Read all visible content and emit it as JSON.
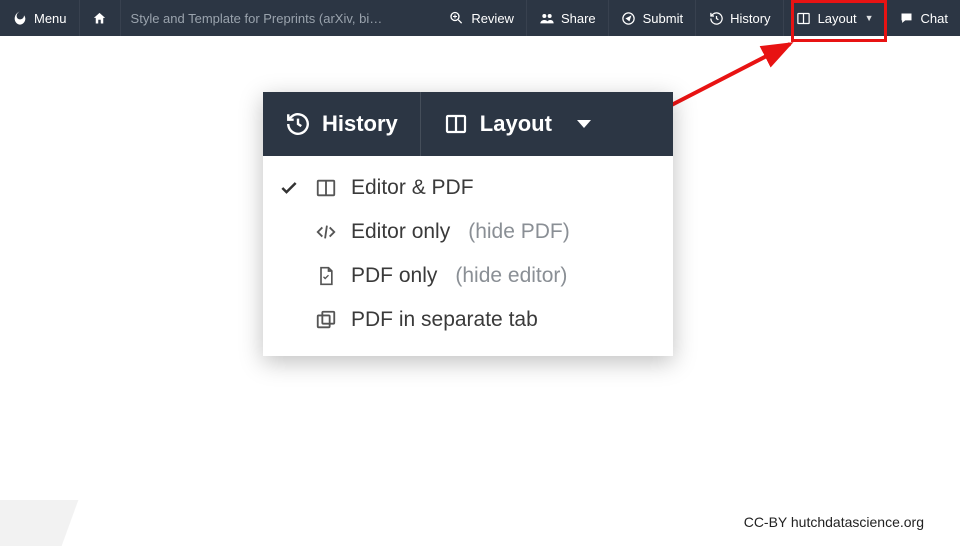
{
  "toolbar": {
    "menu_label": "Menu",
    "title": "Style and Template for Preprints (arXiv, bi…",
    "review_label": "Review",
    "share_label": "Share",
    "submit_label": "Submit",
    "history_label": "History",
    "layout_label": "Layout",
    "chat_label": "Chat"
  },
  "panel": {
    "history_label": "History",
    "layout_label": "Layout"
  },
  "menu": {
    "items": [
      {
        "checked": true,
        "icon": "split-icon",
        "label": "Editor & PDF",
        "note": ""
      },
      {
        "checked": false,
        "icon": "code-icon",
        "label": "Editor only",
        "note": "(hide PDF)"
      },
      {
        "checked": false,
        "icon": "pdf-icon",
        "label": "PDF only",
        "note": "(hide editor)"
      },
      {
        "checked": false,
        "icon": "window-icon",
        "label": "PDF in separate tab",
        "note": ""
      }
    ]
  },
  "attribution": "CC-BY hutchdatascience.org",
  "colors": {
    "highlight": "#e81313",
    "toolbar_bg": "#2c3644"
  }
}
